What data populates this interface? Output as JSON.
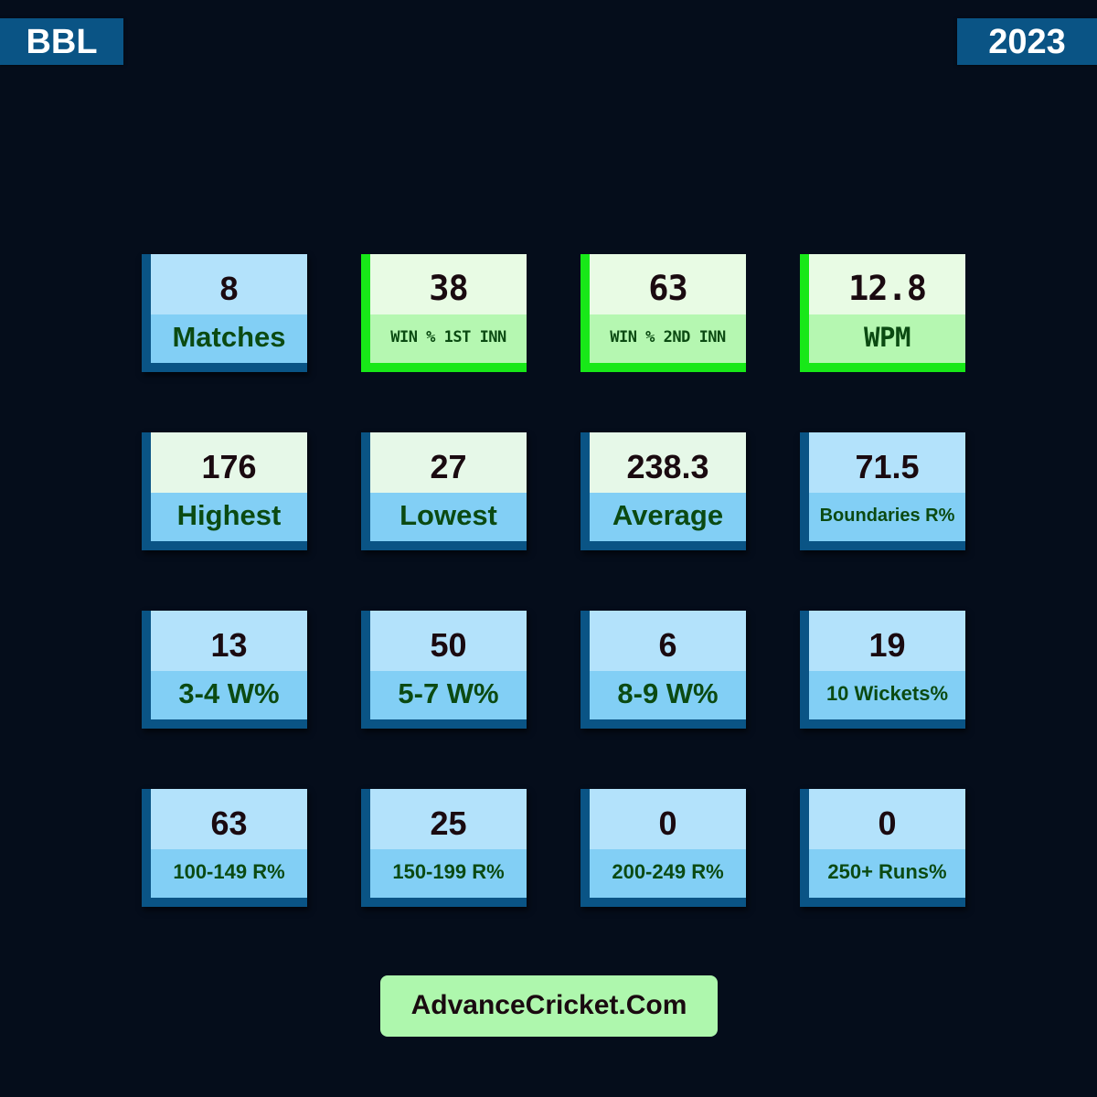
{
  "header": {
    "league": "BBL",
    "year": "2023"
  },
  "stats": [
    [
      {
        "value": "8",
        "label": "Matches",
        "style": "blue"
      },
      {
        "value": "38",
        "label": "WIN % 1ST INN",
        "style": "green"
      },
      {
        "value": "63",
        "label": "WIN % 2ND INN",
        "style": "green"
      },
      {
        "value": "12.8",
        "label": "WPM",
        "style": "green"
      }
    ],
    [
      {
        "value": "176",
        "label": "Highest",
        "style": "mint"
      },
      {
        "value": "27",
        "label": "Lowest",
        "style": "mint"
      },
      {
        "value": "238.3",
        "label": "Average",
        "style": "mint"
      },
      {
        "value": "71.5",
        "label": "Boundaries R%",
        "style": "blue"
      }
    ],
    [
      {
        "value": "13",
        "label": "3-4 W%",
        "style": "blue"
      },
      {
        "value": "50",
        "label": "5-7 W%",
        "style": "blue"
      },
      {
        "value": "6",
        "label": "8-9 W%",
        "style": "blue"
      },
      {
        "value": "19",
        "label": "10 Wickets%",
        "style": "blue"
      }
    ],
    [
      {
        "value": "63",
        "label": "100-149 R%",
        "style": "blue"
      },
      {
        "value": "25",
        "label": "150-199 R%",
        "style": "blue"
      },
      {
        "value": "0",
        "label": "200-249 R%",
        "style": "blue"
      },
      {
        "value": "0",
        "label": "250+ Runs%",
        "style": "blue"
      }
    ]
  ],
  "footer": {
    "brand": "AdvanceCricket.Com"
  },
  "colors": {
    "background": "#050d1b",
    "tag": "#0a5485",
    "accent_green": "#18e818",
    "label_text": "#0b4a12"
  }
}
